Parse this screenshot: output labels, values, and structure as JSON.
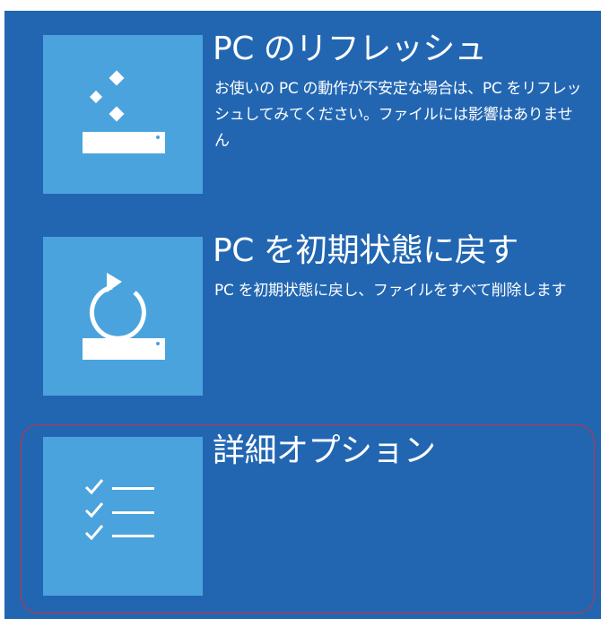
{
  "options": [
    {
      "title": "PC のリフレッシュ",
      "description": "お使いの PC の動作が不安定な場合は、PC をリフレッシュしてみてください。ファイルには影響はありません",
      "icon": "refresh-pc-icon"
    },
    {
      "title": "PC を初期状態に戻す",
      "description": "PC を初期状態に戻し、ファイルをすべて削除します",
      "icon": "reset-pc-icon"
    },
    {
      "title": "詳細オプション",
      "description": "",
      "icon": "checklist-icon"
    }
  ],
  "selected_option": "詳細オプション",
  "colors": {
    "background": "#2266b2",
    "tile": "#4aa3dc",
    "highlight_border": "#c8323c",
    "text": "#ffffff"
  }
}
